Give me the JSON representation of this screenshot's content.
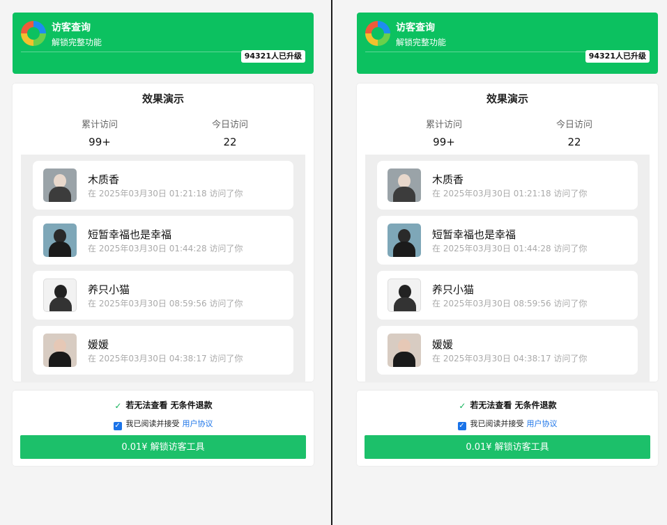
{
  "header": {
    "title": "访客查询",
    "subtitle": "解锁完整功能",
    "badge": "94321人已升级"
  },
  "demo": {
    "title": "效果演示",
    "stats": [
      {
        "label": "累计访问",
        "value": "99+"
      },
      {
        "label": "今日访问",
        "value": "22"
      }
    ],
    "visitors": [
      {
        "name": "木质香",
        "time": "在 2025年03月30日 01:21:18 访问了你"
      },
      {
        "name": "短暂幸福也是幸福",
        "time": "在 2025年03月30日 01:44:28 访问了你"
      },
      {
        "name": "养只小猫",
        "time": "在 2025年03月30日 08:59:56 访问了你"
      },
      {
        "name": "媛媛",
        "time": "在 2025年03月30日 04:38:17 访问了你"
      }
    ]
  },
  "purchase": {
    "guarantee": "若无法查看 无条件退款",
    "agree_text": "我已阅读并接受",
    "agree_link": "用户协议",
    "agree_checked": true,
    "button_label": "0.01¥ 解锁访客工具"
  },
  "colors": {
    "brand_green": "#0cc160",
    "button_green": "#1cc06a",
    "link_blue": "#1a73e8"
  },
  "icons": {
    "logo": "colored-ring-logo",
    "guarantee": "shield-check-icon",
    "checkbox": "check-icon"
  }
}
